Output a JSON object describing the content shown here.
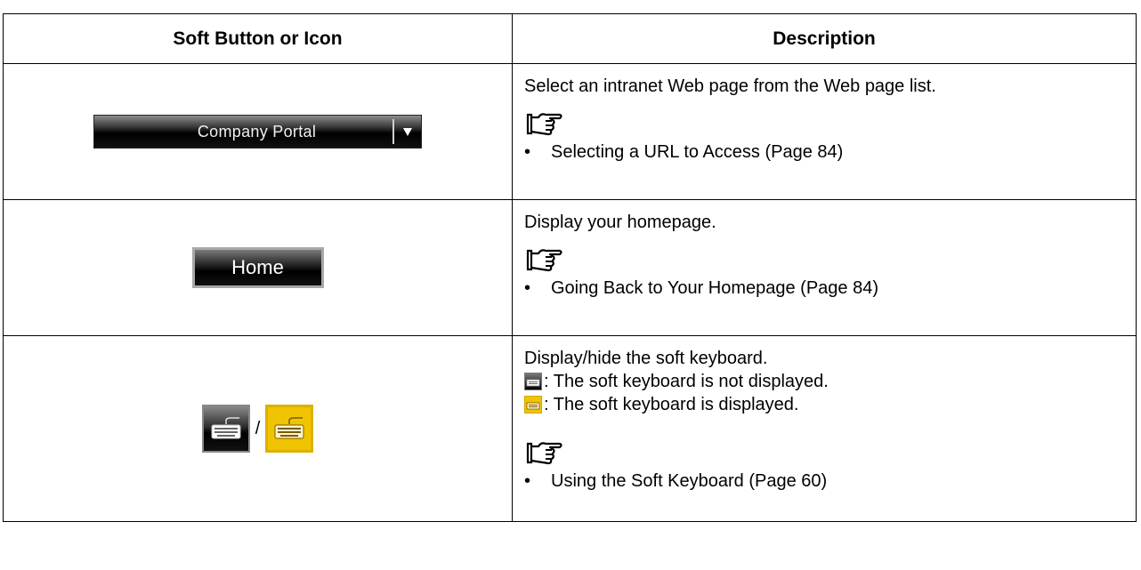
{
  "header": {
    "col1": "Soft Button or Icon",
    "col2": "Description"
  },
  "rows": [
    {
      "button_label": "Company Portal",
      "description": "Select an intranet Web page from the Web page list.",
      "reference_icon": "pointing-hand-reference-icon",
      "reference": "Selecting a URL to Access (Page 84)"
    },
    {
      "button_label": "Home",
      "description": "Display your homepage.",
      "reference_icon": "pointing-hand-reference-icon",
      "reference": "Going Back to Your Homepage (Page 84)"
    },
    {
      "separator": "/",
      "description": "Display/hide the soft keyboard.",
      "state_off": ": The soft keyboard is not displayed.",
      "state_on": ": The soft keyboard is displayed.",
      "reference_icon": "pointing-hand-reference-icon",
      "reference": "Using the Soft Keyboard (Page 60)"
    }
  ],
  "bullet": "•",
  "colors": {
    "button_black": "#000000",
    "keyboard_active": "#f0c400",
    "border": "#000000"
  }
}
